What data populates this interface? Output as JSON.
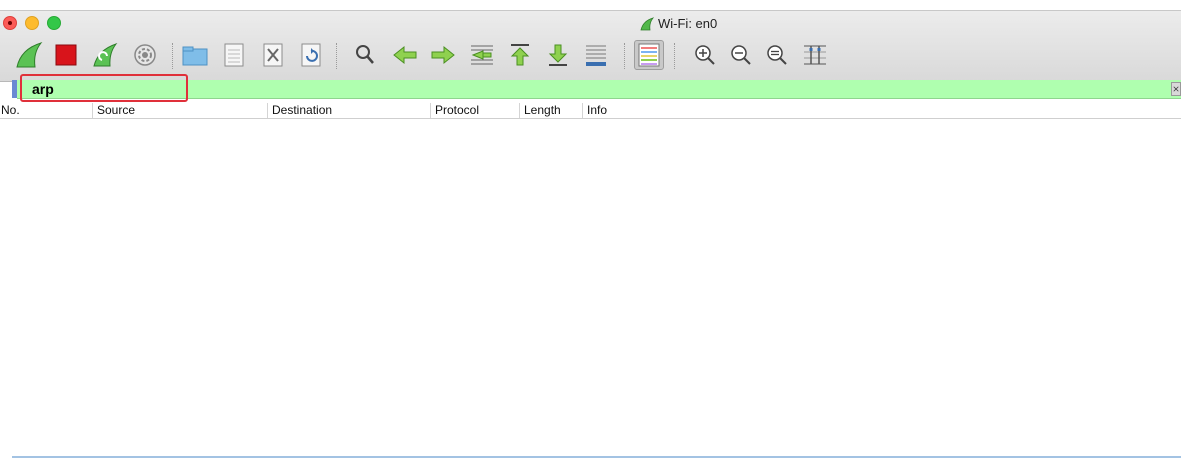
{
  "window": {
    "title": "Wi-Fi: en0"
  },
  "filter": {
    "value": "arp",
    "placeholder": "",
    "clear_symbol": "⨯"
  },
  "columns": [
    {
      "label": "No."
    },
    {
      "label": "Source"
    },
    {
      "label": "Destination"
    },
    {
      "label": "Protocol"
    },
    {
      "label": "Length"
    },
    {
      "label": "Info"
    }
  ],
  "toolbar_icons": [
    "start-capture-fin-icon",
    "stop-capture-icon",
    "restart-capture-fin-icon",
    "capture-options-gear-icon",
    "open-file-folder-icon",
    "save-file-icon",
    "close-file-icon",
    "reload-file-icon",
    "find-packet-icon",
    "go-back-icon",
    "go-forward-icon",
    "go-to-packet-icon",
    "go-first-packet-icon",
    "go-last-packet-icon",
    "auto-scroll-icon",
    "colorize-icon",
    "zoom-in-icon",
    "zoom-out-icon",
    "zoom-normal-icon",
    "resize-columns-icon"
  ],
  "colors": {
    "filter_valid": "#afffaf",
    "highlight": "#e0303a",
    "accent": "#3c8ee8"
  }
}
